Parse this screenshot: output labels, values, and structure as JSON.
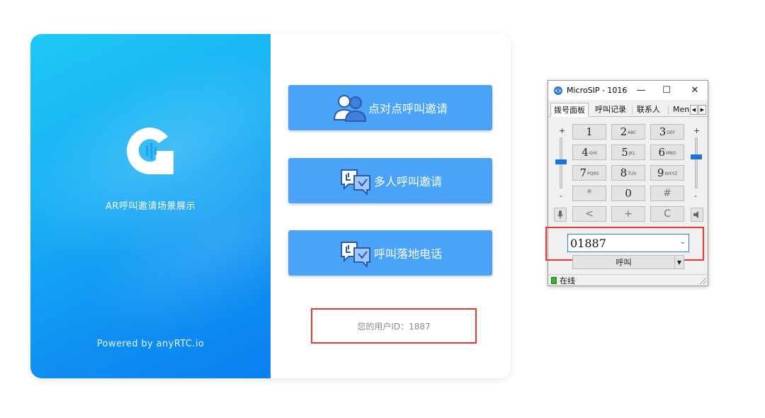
{
  "app": {
    "title": "AR呼叫邀请场景展示",
    "powered_by": "Powered by anyRTC.io",
    "buttons": {
      "p2p": "点对点呼叫邀请",
      "multi": "多人呼叫邀请",
      "landline": "呼叫落地电话"
    },
    "user_id": "您的用户ID：1887",
    "colors": {
      "accent": "#4aa3f7",
      "highlight": "#e53935"
    }
  },
  "sip": {
    "title": "MicroSIP - 1016",
    "controls": {
      "minimize": "—",
      "maximize": "☐",
      "close": "✕"
    },
    "tabs": [
      "拨号面板",
      "呼叫记录",
      "联系人",
      "Menu"
    ],
    "tab_arrows": {
      "left": "◀",
      "right": "▶"
    },
    "volume": {
      "plus": "+",
      "minus": "-"
    },
    "keys": [
      {
        "main": "1",
        "sub": ""
      },
      {
        "main": "2",
        "sub": "ABC"
      },
      {
        "main": "3",
        "sub": "DEF"
      },
      {
        "main": "4",
        "sub": "GHI"
      },
      {
        "main": "5",
        "sub": "JKL"
      },
      {
        "main": "6",
        "sub": "MNO"
      },
      {
        "main": "7",
        "sub": "PQRS"
      },
      {
        "main": "8",
        "sub": "TUV"
      },
      {
        "main": "9",
        "sub": "WXYZ"
      },
      {
        "main": "*",
        "sub": ""
      },
      {
        "main": "0",
        "sub": ""
      },
      {
        "main": "#",
        "sub": ""
      }
    ],
    "function_keys": {
      "back": "<",
      "plus": "+",
      "clear": "C"
    },
    "dial_value": "01887",
    "dropdown_chevron": "⌄",
    "call_label": "呼叫",
    "call_dropdown": "▼",
    "status": "在线"
  }
}
